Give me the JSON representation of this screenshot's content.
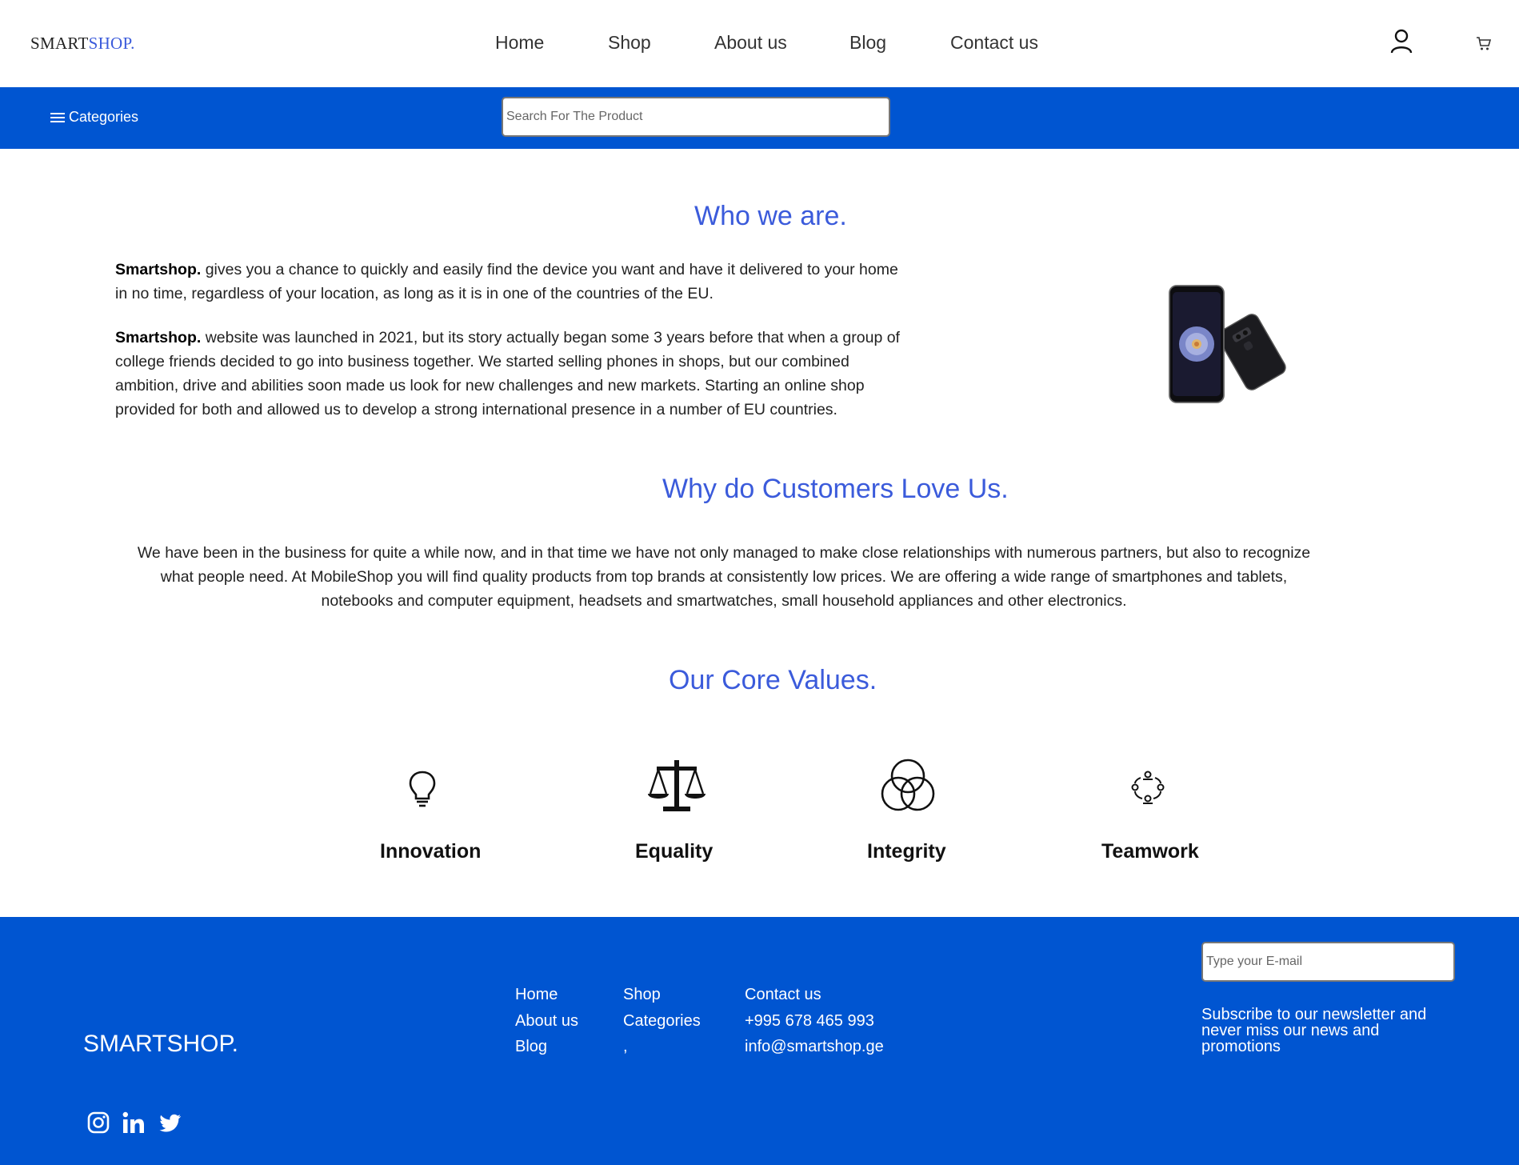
{
  "header": {
    "logo_main": "SMART",
    "logo_accent": "SHOP.",
    "nav": [
      "Home",
      "Shop",
      "About us",
      "Blog",
      "Contact us"
    ]
  },
  "toolbar": {
    "categories_label": "Categories",
    "search_placeholder": "Search For The Product"
  },
  "about": {
    "title": "Who we are.",
    "p1_bold": "Smartshop.",
    "p1_line1": " gives you a chance to quickly and easily find the device you want and have it delivered to your home",
    "p1_line2": "in no time, regardless of your location, as long as it is in one of the countries of the EU.",
    "p2_bold": "Smartshop.",
    "p2_line1": " website was launched in 2021, but its story actually began some 3 years before that when a group of",
    "p2_line2": "college friends decided to go into business together. We started selling phones in shops, but our combined",
    "p2_line3": "ambition, drive and abilities soon made us look for new challenges and new markets. Starting an online shop",
    "p2_line4": "provided for both and allowed us to develop a strong international presence in a number of EU countries."
  },
  "why": {
    "title": "Why do Customers Love Us.",
    "line1": "We have been in the business for quite a while now, and in that time we have not only managed to make close relationships with numerous partners, but also to recognize",
    "line2": "what people need. At MobileShop you will find quality products from top brands at consistently low prices. We are offering a wide range of smartphones and tablets,",
    "line3": "notebooks and computer equipment, headsets and smartwatches, small household appliances and other electronics."
  },
  "values": {
    "title": "Our Core Values.",
    "items": [
      {
        "label": "Innovation",
        "icon": "lightbulb-icon"
      },
      {
        "label": "Equality",
        "icon": "scales-icon"
      },
      {
        "label": "Integrity",
        "icon": "circles-icon"
      },
      {
        "label": "Teamwork",
        "icon": "team-icon"
      }
    ]
  },
  "footer": {
    "logo": "SMARTSHOP.",
    "col1": [
      "Home",
      "About us",
      "Blog"
    ],
    "col2": [
      "Shop",
      "Categories",
      ","
    ],
    "col3": [
      "Contact us",
      "+995 678 465 993",
      "info@smartshop.ge"
    ],
    "email_placeholder": "Type your E-mail",
    "newsletter": "Subscribe to our newsletter and never miss our news and promotions",
    "socials": [
      "instagram-icon",
      "linkedin-icon",
      "twitter-icon"
    ]
  },
  "colors": {
    "brand_blue": "#0055d1",
    "heading_blue": "#3b5bdb"
  }
}
